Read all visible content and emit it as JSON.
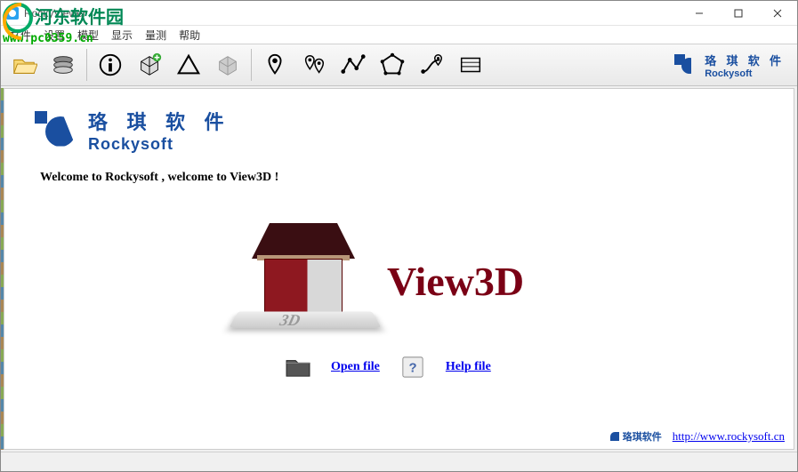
{
  "watermark": {
    "text": "河东软件园",
    "url": "www.pc0359.cn"
  },
  "window": {
    "title": "RockyViewer"
  },
  "menu": {
    "items": [
      "文件",
      "设置",
      "模型",
      "显示",
      "量测",
      "帮助"
    ]
  },
  "toolbar": {
    "items": [
      "open-model",
      "layers",
      "info",
      "add-model",
      "triangle",
      "cube",
      "point-single",
      "point-multi",
      "polyline",
      "polygon",
      "route",
      "table"
    ]
  },
  "brand": {
    "cn": "珞 琪 软 件",
    "en": "Rockysoft"
  },
  "content": {
    "logo_cn": "珞 琪 软 件",
    "logo_en": "Rockysoft",
    "welcome": "Welcome to Rockysoft , welcome to View3D !",
    "hero_title": "View3D",
    "house_label": "3D",
    "links": {
      "open": "Open file",
      "help": "Help file"
    }
  },
  "footer": {
    "brand": "珞琪软件",
    "url": "http://www.rockysoft.cn"
  }
}
